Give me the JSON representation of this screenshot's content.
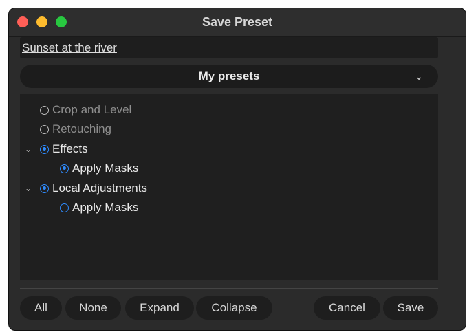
{
  "window": {
    "title": "Save Preset"
  },
  "preset_name": {
    "value": "Sunset at the river"
  },
  "preset_group": {
    "selected": "My presets"
  },
  "tree": {
    "crop_and_level": "Crop and Level",
    "retouching": "Retouching",
    "effects": "Effects",
    "effects_apply_masks": "Apply Masks",
    "local_adjustments": "Local Adjustments",
    "local_apply_masks": "Apply Masks"
  },
  "buttons": {
    "all": "All",
    "none": "None",
    "expand": "Expand",
    "collapse": "Collapse",
    "cancel": "Cancel",
    "save": "Save"
  },
  "colors": {
    "accent": "#2f8cff",
    "close": "#ff5f57",
    "minimize": "#febc2e",
    "zoom": "#28c840"
  }
}
